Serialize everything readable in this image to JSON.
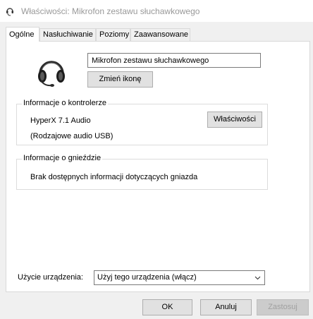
{
  "window": {
    "title": "Właściwości: Mikrofon zestawu słuchawkowego"
  },
  "tabs": [
    {
      "label": "Ogólne",
      "active": true
    },
    {
      "label": "Nasłuchiwanie",
      "active": false
    },
    {
      "label": "Poziomy",
      "active": false
    },
    {
      "label": "Zaawansowane",
      "active": false
    }
  ],
  "general": {
    "device_name": "Mikrofon zestawu słuchawkowego",
    "change_icon_label": "Zmień ikonę",
    "icon": "headset-icon"
  },
  "controller": {
    "legend": "Informacje o kontrolerze",
    "name": "HyperX 7.1 Audio",
    "driver": "(Rodzajowe audio USB)",
    "properties_label": "Właściwości"
  },
  "jack": {
    "legend": "Informacje o gnieździe",
    "info": "Brak dostępnych informacji dotyczących gniazda"
  },
  "usage": {
    "label": "Użycie urządzenia:",
    "selected": "Użyj tego urządzenia (włącz)"
  },
  "buttons": {
    "ok": "OK",
    "cancel": "Anuluj",
    "apply": "Zastosuj"
  },
  "colors": {
    "title_text": "#999999",
    "disabled_text": "#a0a0a0"
  }
}
